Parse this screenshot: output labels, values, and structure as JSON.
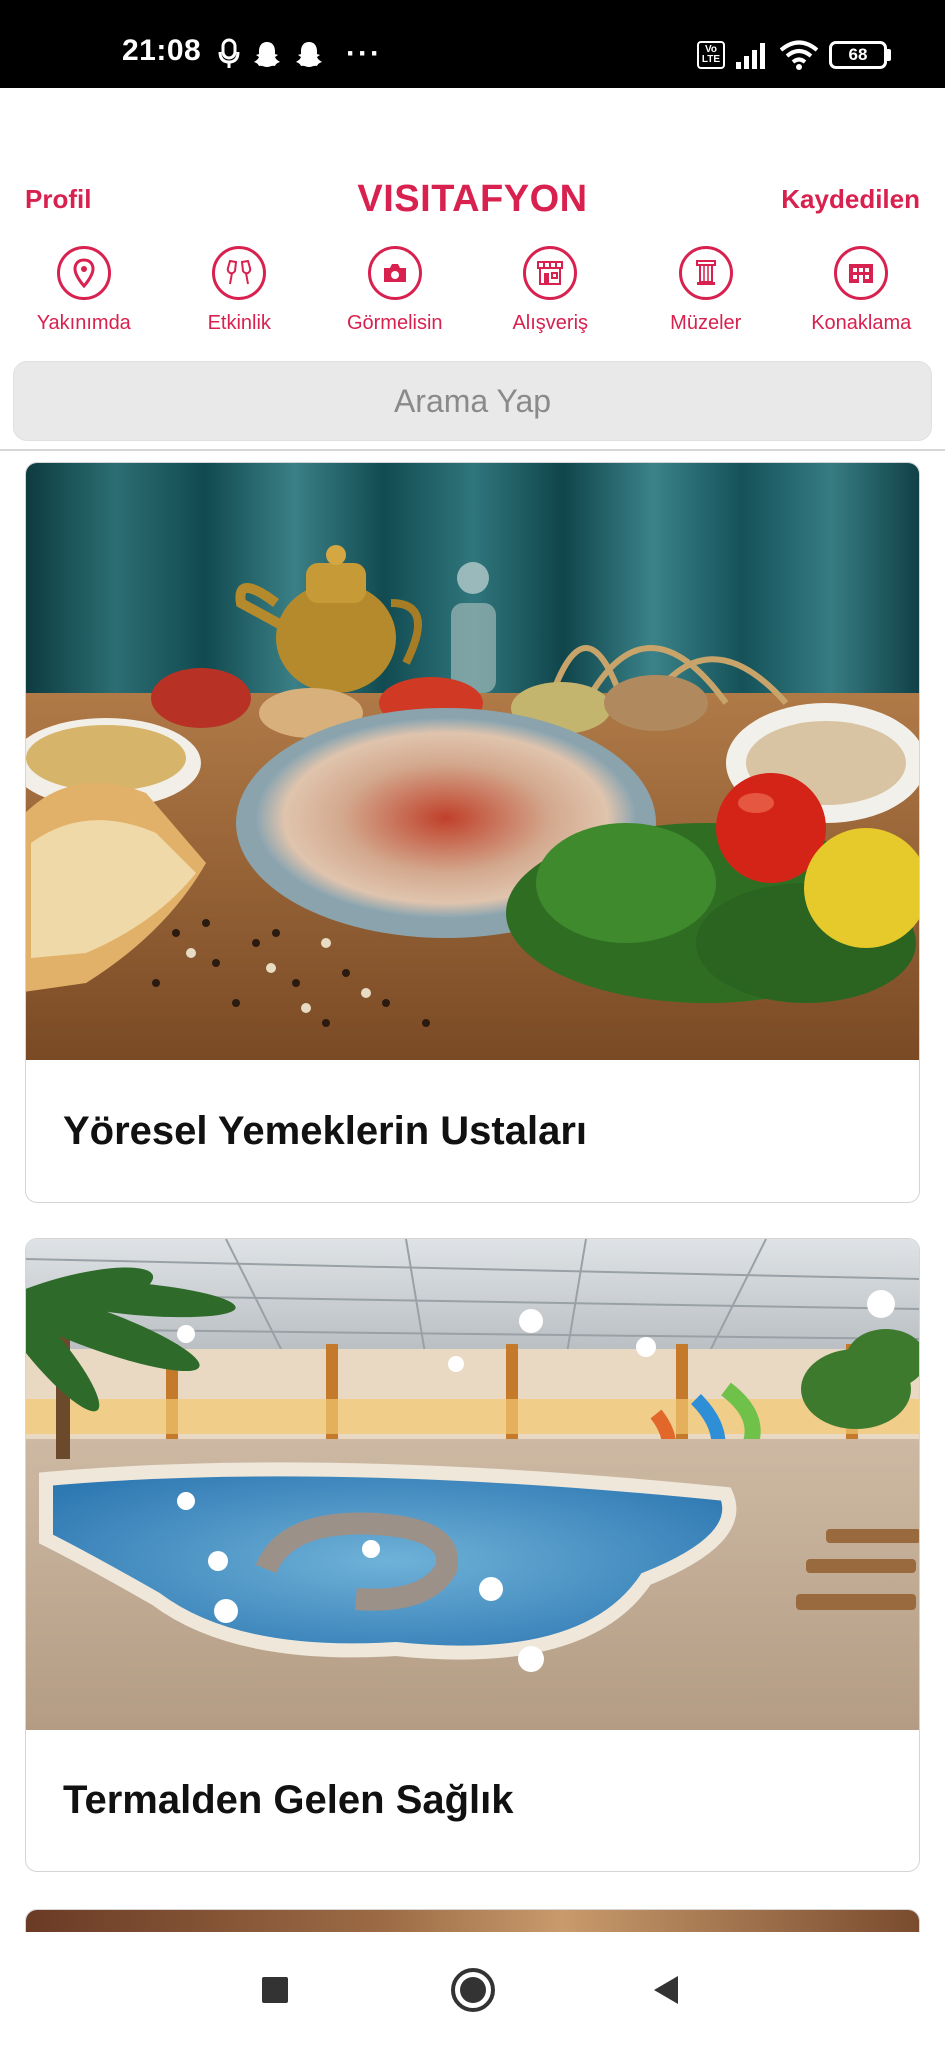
{
  "status_bar": {
    "time": "21:08",
    "overflow": "···",
    "volte_top": "Vo",
    "volte_bottom": "LTE",
    "battery": "68",
    "icons": [
      "mic-icon",
      "snapchat-icon",
      "snapchat-icon",
      "signal-icon",
      "wifi-icon",
      "battery-icon"
    ]
  },
  "header": {
    "left_link": "Profil",
    "title": "VISITAFYON",
    "right_link": "Kaydedilen"
  },
  "categories": [
    {
      "label": "Yakınımda",
      "icon": "location-pin-icon"
    },
    {
      "label": "Etkinlik",
      "icon": "toast-glasses-icon"
    },
    {
      "label": "Görmelisin",
      "icon": "camera-icon"
    },
    {
      "label": "Alışveriş",
      "icon": "store-icon"
    },
    {
      "label": "Müzeler",
      "icon": "column-icon"
    },
    {
      "label": "Konaklama",
      "icon": "hotel-icon"
    }
  ],
  "search": {
    "placeholder": "Arama Yap"
  },
  "feed": {
    "cards": [
      {
        "title": "Yöresel Yemeklerin Ustaları",
        "image": "regional-food-photo"
      },
      {
        "title": "Termalden Gelen Sağlık",
        "image": "thermal-pool-photo"
      }
    ]
  },
  "colors": {
    "accent": "#d8214f",
    "search_bg": "#e9e9e9",
    "card_border": "#d5d5d5"
  }
}
